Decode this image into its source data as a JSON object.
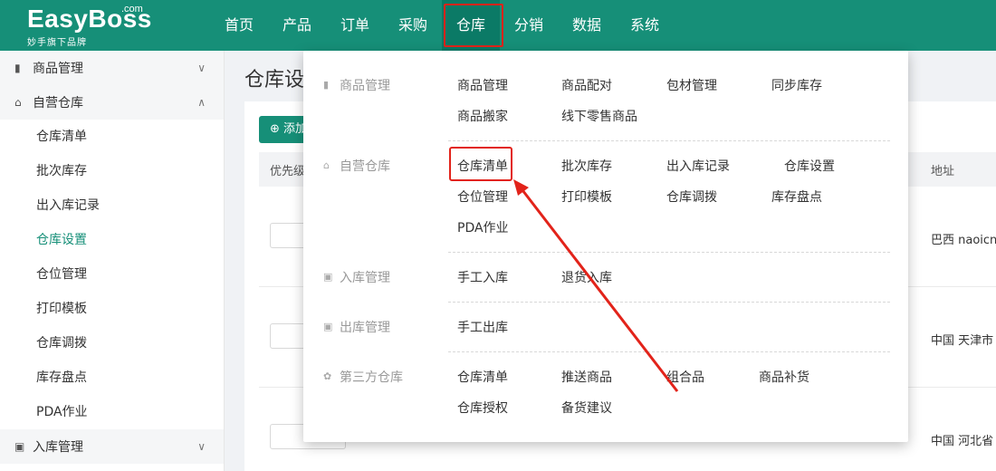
{
  "logo": {
    "main": "EasyBoss",
    "com": ".com",
    "sub": "妙手旗下品牌"
  },
  "nav": [
    "首页",
    "产品",
    "订单",
    "采购",
    "仓库",
    "分销",
    "数据",
    "系统"
  ],
  "sidebar": {
    "groups": [
      {
        "label": "商品管理",
        "icon": "clipboard-icon",
        "chevron": "∨"
      },
      {
        "label": "自营仓库",
        "icon": "home-icon",
        "chevron": "∧"
      },
      {
        "label": "入库管理",
        "icon": "inbox-icon",
        "chevron": "∨"
      }
    ],
    "items": [
      "仓库清单",
      "批次库存",
      "出入库记录",
      "仓库设置",
      "仓位管理",
      "打印模板",
      "仓库调拨",
      "库存盘点",
      "PDA作业"
    ]
  },
  "main": {
    "title": "仓库设",
    "add_button": "⊕ 添加",
    "th_priority": "优先级",
    "th_address": "地址",
    "addresses": [
      "巴西 naoicns",
      "中国 天津市",
      "中国 河北省"
    ]
  },
  "dropdown": {
    "sections": [
      {
        "head": "商品管理",
        "links": [
          "商品管理",
          "商品配对",
          "包材管理",
          "同步库存",
          "商品搬家",
          "线下零售商品"
        ]
      },
      {
        "head": "自营仓库",
        "links": [
          "仓库清单",
          "批次库存",
          "出入库记录",
          "仓库设置",
          "仓位管理",
          "打印模板",
          "仓库调拨",
          "库存盘点",
          "PDA作业"
        ]
      },
      {
        "head": "入库管理",
        "links": [
          "手工入库",
          "退货入库"
        ]
      },
      {
        "head": "出库管理",
        "links": [
          "手工出库"
        ]
      },
      {
        "head": "第三方仓库",
        "links": [
          "仓库清单",
          "推送商品",
          "组合品",
          "商品补货",
          "仓库授权",
          "备货建议"
        ]
      }
    ]
  },
  "colors": {
    "brand": "#168f78",
    "highlight": "#e2231a"
  }
}
